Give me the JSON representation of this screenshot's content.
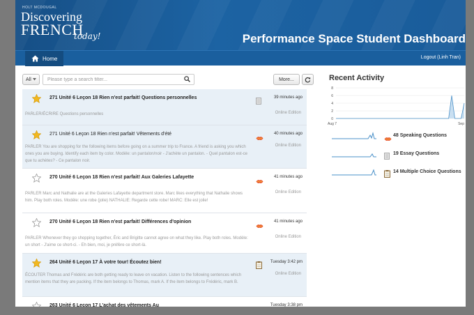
{
  "header": {
    "publisher": "HOLT MCDOUGAL",
    "logo_line1": "Discovering",
    "logo_line2": "FRENCH",
    "logo_line3": "today!",
    "title": "Performance Space Student Dashboard"
  },
  "nav": {
    "home_label": "Home",
    "logout_label": "Logout (Linh Tran)"
  },
  "toolbar": {
    "filter_select": "All",
    "search_placeholder": "Please type a search filter...",
    "more_label": "More..."
  },
  "rows": [
    {
      "title_bold": "271 Unité 6 Leçon 18 Rien n'est parfait! Questions personnelles",
      "title_rest": "",
      "desc": "PARLER/ÉCRIRE Questions personnelles",
      "time": "39 minutes ago",
      "edition": "Online Edition",
      "starred": true,
      "icon": "essay-doc-icon"
    },
    {
      "title_bold": "",
      "title_rest": "271 Unité 6 Leçon 18 Rien n'est parfait! Vêtements d'été",
      "desc": "PARLER You are shopping for the following items before going on a summer trip to France. A friend is asking you which ones you are buying. Identify each item by color. Modèle: un pantalon/noir - J'achète un pantalon. - Quel pantalon est-ce que tu achètes? - Ce pantalon noir.",
      "time": "40 minutes ago",
      "edition": "Online Edition",
      "starred": true,
      "icon": "speaking-lips-icon"
    },
    {
      "title_bold": "270 Unité 6 Leçon 18 Rien n'est parfait! Aux Galeries Lafayette",
      "title_rest": "",
      "desc": "PARLER Marc and Nathalie are at the Galeries Lafayette department store. Marc likes everything that Nathalie shows him. Play both roles. Modèle: une robe (jolie) NATHALIE: Regarde cette robe! MARC: Elle est jolie!",
      "time": "41 minutes ago",
      "edition": "Online Edition",
      "starred": false,
      "icon": "speaking-lips-icon"
    },
    {
      "title_bold": "270 Unité 6 Leçon 18 Rien n'est parfait! Différences d'opinion",
      "title_rest": "",
      "desc": "PARLER Whenever they go shopping together, Éric and Brigitte cannot agree on what they like. Play both roles. Modèle: un short - J'aime ce short-ci. - Eh bien, moi, je préfère ce short-là.",
      "time": "41 minutes ago",
      "edition": "Online Edition",
      "starred": false,
      "icon": "speaking-lips-icon"
    },
    {
      "title_bold": "264 Unité 6 Leçon 17 À votre tour! Écoutez bien!",
      "title_rest": "",
      "desc": "ÉCOUTER Thomas and Frédéric are both getting ready to leave on vacation. Listen to the following sentences which mention items that they are packing. If the item belongs to Thomas, mark A. If the item belongs to Frédéric, mark B.",
      "time": "Tuesday 3:42 pm",
      "edition": "Online Edition",
      "starred": true,
      "icon": "multiple-choice-icon"
    },
    {
      "title_bold": "263 Unité 6 Leçon 17 L'achat des vêtements Au",
      "title_rest": "",
      "desc": "",
      "time": "Tuesday 3:38 pm",
      "edition": "",
      "starred": false,
      "icon": "speaking-lips-icon"
    }
  ],
  "recent": {
    "title": "Recent Activity",
    "legend": [
      {
        "label": "48 Speaking Questions",
        "icon": "speaking-lips-icon"
      },
      {
        "label": "19 Essay Questions",
        "icon": "essay-doc-icon"
      },
      {
        "label": "14 Multiple Choice Questions",
        "icon": "multiple-choice-icon"
      }
    ]
  },
  "chart_data": {
    "type": "line",
    "x_start_label": "Aug 7",
    "x_end_label": "Sep",
    "y_ticks": [
      0,
      2,
      4,
      6,
      8
    ],
    "ylim": [
      0,
      8
    ],
    "series": [
      {
        "name": "",
        "values": [
          0,
          0,
          0,
          0,
          0,
          0,
          0,
          0,
          0,
          0,
          0,
          0,
          0,
          0,
          0,
          0,
          0,
          0,
          0,
          0,
          0,
          0,
          0,
          0,
          0,
          0,
          0,
          0,
          0,
          0,
          0,
          0,
          0,
          0,
          0,
          0,
          0,
          6,
          0,
          0,
          0,
          4
        ]
      }
    ],
    "colors": {
      "line": "#4a90c8",
      "fill": "#c9dff1"
    }
  }
}
